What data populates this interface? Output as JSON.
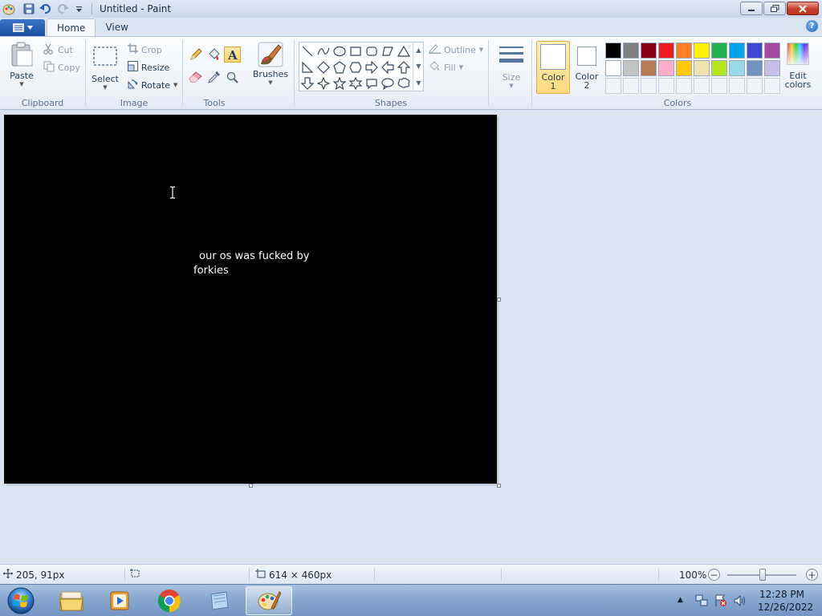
{
  "window": {
    "title": "Untitled - Paint"
  },
  "ribbon": {
    "tabs": [
      "Home",
      "View"
    ],
    "clipboard": {
      "label": "Clipboard",
      "paste": "Paste",
      "cut": "Cut",
      "copy": "Copy"
    },
    "image": {
      "label": "Image",
      "select": "Select",
      "crop": "Crop",
      "resize": "Resize",
      "rotate": "Rotate"
    },
    "tools": {
      "label": "Tools"
    },
    "brushes": {
      "label": "Brushes"
    },
    "shapes": {
      "label": "Shapes",
      "outline": "Outline",
      "fill": "Fill"
    },
    "size": {
      "label": "Size"
    },
    "colors": {
      "label": "Colors",
      "color1": "Color\n1",
      "color2": "Color\n2",
      "color1_line1": "Color",
      "color1_line2": "1",
      "color2_line1": "Color",
      "color2_line2": "2",
      "edit_line1": "Edit",
      "edit_line2": "colors",
      "palette_row1": [
        "#000000",
        "#7f7f7f",
        "#880015",
        "#ed1c24",
        "#ff7f27",
        "#fff200",
        "#22b14c",
        "#00a2e8",
        "#3f48cc",
        "#a349a4"
      ],
      "palette_row2": [
        "#ffffff",
        "#c3c3c3",
        "#b97a57",
        "#ffaec9",
        "#ffc90e",
        "#efe4b0",
        "#b5e61d",
        "#99d9ea",
        "#7092be",
        "#c8bfe7"
      ],
      "palette_row3": [
        "#f0f4f9",
        "#f0f4f9",
        "#f0f4f9",
        "#f0f4f9",
        "#f0f4f9",
        "#f0f4f9",
        "#f0f4f9",
        "#f0f4f9",
        "#f0f4f9",
        "#f0f4f9"
      ]
    }
  },
  "canvas": {
    "text_line1": "our os was fucked by",
    "text_line2": "forkies",
    "background": "#000000"
  },
  "status": {
    "cursor_pos": "205, 91px",
    "image_size": "614 × 460px",
    "zoom": "100%"
  },
  "taskbar": {
    "time": "12:28 PM",
    "date": "12/26/2022"
  }
}
